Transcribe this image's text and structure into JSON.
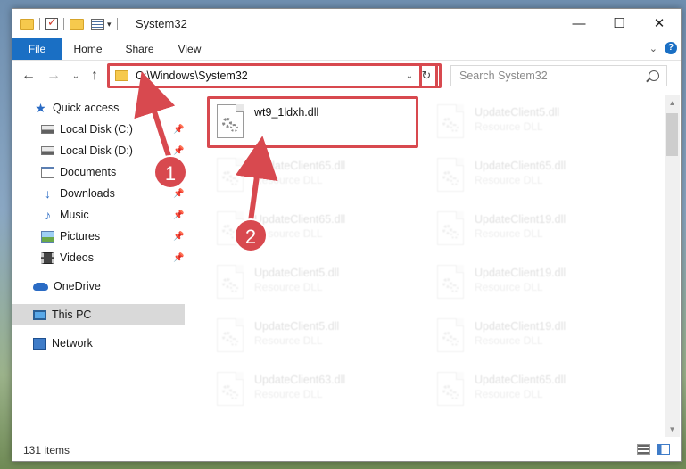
{
  "window": {
    "title": "System32"
  },
  "title_buttons": {
    "minimize": "—",
    "maximize": "☐",
    "close": "✕"
  },
  "ribbon": {
    "tabs": [
      {
        "label": "File"
      },
      {
        "label": "Home"
      },
      {
        "label": "Share"
      },
      {
        "label": "View"
      }
    ],
    "expand": "⌄",
    "help": "?"
  },
  "nav": {
    "back": "←",
    "forward": "→",
    "recent": "⌄",
    "up": "↑",
    "address": "C:\\Windows\\System32",
    "address_dropdown": "⌄",
    "refresh": "↻",
    "search_placeholder": "Search System32"
  },
  "sidebar": {
    "items": [
      {
        "label": "Quick access",
        "icon": "star-icon"
      },
      {
        "label": "Local Disk (C:)",
        "icon": "disk-icon",
        "pinned": true
      },
      {
        "label": "Local Disk (D:)",
        "icon": "disk-icon",
        "pinned": true
      },
      {
        "label": "Documents",
        "icon": "documents-icon",
        "pinned": true
      },
      {
        "label": "Downloads",
        "icon": "downloads-icon",
        "pinned": true
      },
      {
        "label": "Music",
        "icon": "music-icon",
        "pinned": true
      },
      {
        "label": "Pictures",
        "icon": "pictures-icon",
        "pinned": true
      },
      {
        "label": "Videos",
        "icon": "videos-icon",
        "pinned": true
      },
      {
        "label": "OneDrive",
        "icon": "onedrive-icon"
      },
      {
        "label": "This PC",
        "icon": "this-pc-icon",
        "selected": true
      },
      {
        "label": "Network",
        "icon": "network-icon"
      }
    ]
  },
  "files": {
    "highlighted": {
      "name": "wt9_1ldxh.dll"
    },
    "left_column": [
      {
        "name": "UpdateClient65.dll",
        "type": "Resource DLL"
      },
      {
        "name": "UpdateClient65.dll",
        "type": "Resource DLL"
      },
      {
        "name": "UpdateClient5.dll",
        "type": "Resource DLL"
      },
      {
        "name": "UpdateClient5.dll",
        "type": "Resource DLL"
      },
      {
        "name": "UpdateClient63.dll",
        "type": "Resource DLL"
      }
    ],
    "right_column": [
      {
        "name": "UpdateClient5.dll",
        "type": "Resource DLL"
      },
      {
        "name": "UpdateClient65.dll",
        "type": "Resource DLL"
      },
      {
        "name": "UpdateClient19.dll",
        "type": "Resource DLL"
      },
      {
        "name": "UpdateClient19.dll",
        "type": "Resource DLL"
      },
      {
        "name": "UpdateClient19.dll",
        "type": "Resource DLL"
      },
      {
        "name": "UpdateClient65.dll",
        "type": "Resource DLL"
      }
    ]
  },
  "annotations": {
    "step1": "1",
    "step2": "2",
    "color": "#d8494f"
  },
  "status": {
    "item_count": "131 items"
  }
}
